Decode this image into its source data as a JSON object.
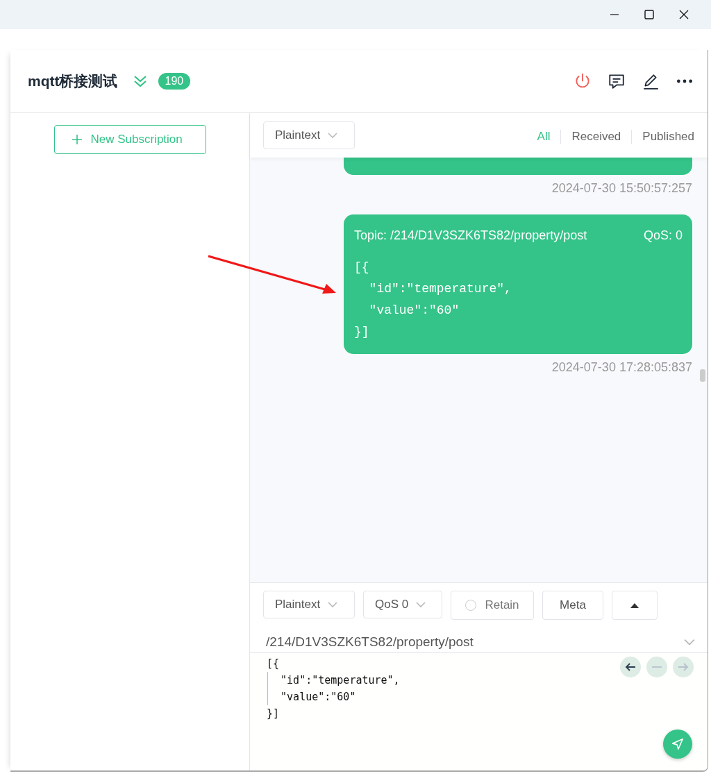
{
  "header": {
    "title": "mqtt桥接测试",
    "count": "190"
  },
  "sidebar": {
    "new_subscription": "New Subscription"
  },
  "toolbar": {
    "format": "Plaintext",
    "filters": [
      {
        "label": "All",
        "selected": true
      },
      {
        "label": "Received",
        "selected": false
      },
      {
        "label": "Published",
        "selected": false
      }
    ]
  },
  "messages": [
    {
      "timestamp": "2024-07-30 15:50:57:257"
    },
    {
      "topic": "Topic: /214/D1V3SZK6TS82/property/post",
      "qos": "QoS: 0",
      "payload": [
        "[{",
        "  \"id\":\"temperature\",",
        "  \"value\":\"60\"",
        "}]"
      ],
      "timestamp": "2024-07-30 17:28:05:837"
    }
  ],
  "publish": {
    "format": "Plaintext",
    "qos": "QoS 0",
    "retain": {
      "label": "Retain",
      "checked": false
    },
    "meta": "Meta",
    "topic": "/214/D1V3SZK6TS82/property/post",
    "payload": [
      "[{",
      "  \"id\":\"temperature\",",
      "  \"value\":\"60\"",
      "}]"
    ],
    "history": [
      {
        "kind": "back",
        "disabled": false
      },
      {
        "kind": "clear",
        "disabled": true
      },
      {
        "kind": "forward",
        "disabled": true
      }
    ]
  }
}
